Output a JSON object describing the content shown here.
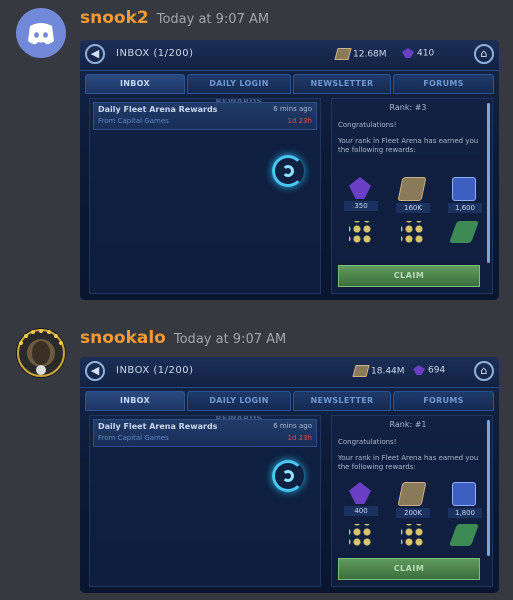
{
  "messages": [
    {
      "username": "snook2",
      "timestamp": "Today at 9:07 AM",
      "avatar": "discord-logo-icon",
      "game": {
        "inbox_title": "INBOX (1/200)",
        "credits": "12.68M",
        "crystals": "410",
        "tabs": [
          "INBOX",
          "DAILY LOGIN REWARDS",
          "NEWSLETTER",
          "FORUMS"
        ],
        "active_tab": "INBOX",
        "mail": {
          "title": "Daily Fleet Arena Rewards",
          "from": "From Capital Games",
          "age": "6 mins ago",
          "expires": "1d 23h"
        },
        "detail": {
          "rank": "Rank: #3",
          "congrats": "Congratulations!",
          "body": "Your rank in Fleet Arena has earned you the following rewards:",
          "rewards": [
            {
              "icon": "crystals-icon",
              "qty": "350"
            },
            {
              "icon": "credits-icon",
              "qty": "160K"
            },
            {
              "icon": "fleet-arena-token-icon",
              "qty": "1,600"
            },
            {
              "icon": "ship-shards-icon",
              "qty": ""
            },
            {
              "icon": "ship-shards-icon",
              "qty": ""
            },
            {
              "icon": "training-droid-icon",
              "qty": ""
            }
          ],
          "claim_label": "CLAIM"
        }
      }
    },
    {
      "username": "snookalo",
      "timestamp": "Today at 9:07 AM",
      "avatar": "ship-avatar-icon",
      "game": {
        "inbox_title": "INBOX (1/200)",
        "credits": "18.44M",
        "crystals": "694",
        "tabs": [
          "INBOX",
          "DAILY LOGIN REWARDS",
          "NEWSLETTER",
          "FORUMS"
        ],
        "active_tab": "INBOX",
        "mail": {
          "title": "Daily Fleet Arena Rewards",
          "from": "From Capital Games",
          "age": "6 mins ago",
          "expires": "1d 23h"
        },
        "detail": {
          "rank": "Rank: #1",
          "congrats": "Congratulations!",
          "body": "Your rank in Fleet Arena has earned you the following rewards:",
          "rewards": [
            {
              "icon": "crystals-icon",
              "qty": "400"
            },
            {
              "icon": "credits-icon",
              "qty": "200K"
            },
            {
              "icon": "fleet-arena-token-icon",
              "qty": "1,800"
            },
            {
              "icon": "ship-shards-icon",
              "qty": ""
            },
            {
              "icon": "ship-shards-icon",
              "qty": ""
            },
            {
              "icon": "training-droid-icon",
              "qty": ""
            }
          ],
          "claim_label": "CLAIM"
        }
      }
    }
  ],
  "colors": {
    "background": "#36393f",
    "username": "#f69a33",
    "timestamp": "#a3a6aa",
    "discord_blurple": "#7289da",
    "claim_green": "#4d864c",
    "spinner_cyan": "#46c8f2",
    "expire_red": "#e14b4b"
  }
}
